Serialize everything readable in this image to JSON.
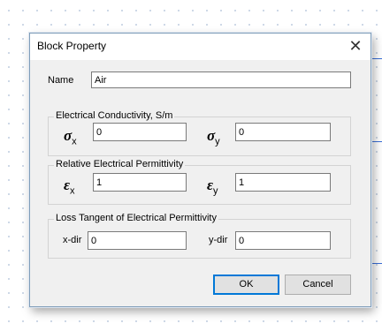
{
  "dialog": {
    "title": "Block Property",
    "close_glyph": "✕"
  },
  "name_field": {
    "label": "Name",
    "value": "Air"
  },
  "conductivity": {
    "title": "Electrical Conductivity, S/m",
    "x_symbol": "σ",
    "x_sub": "x",
    "x_value": "0",
    "y_symbol": "σ",
    "y_sub": "y",
    "y_value": "0"
  },
  "permittivity": {
    "title": "Relative Electrical Permittivity",
    "x_symbol": "ε",
    "x_sub": "x",
    "x_value": "1",
    "y_symbol": "ε",
    "y_sub": "y",
    "y_value": "1"
  },
  "loss_tangent": {
    "title": "Loss Tangent of Electrical Permittivity",
    "x_label": "x-dir",
    "x_value": "0",
    "y_label": "y-dir",
    "y_value": "0"
  },
  "buttons": {
    "ok": "OK",
    "cancel": "Cancel"
  },
  "colors": {
    "dialog_bg": "#f0f0f0",
    "grid_dot": "#8fa6c8",
    "accent": "#0078d7",
    "canvas_line": "#3a6fd8"
  }
}
